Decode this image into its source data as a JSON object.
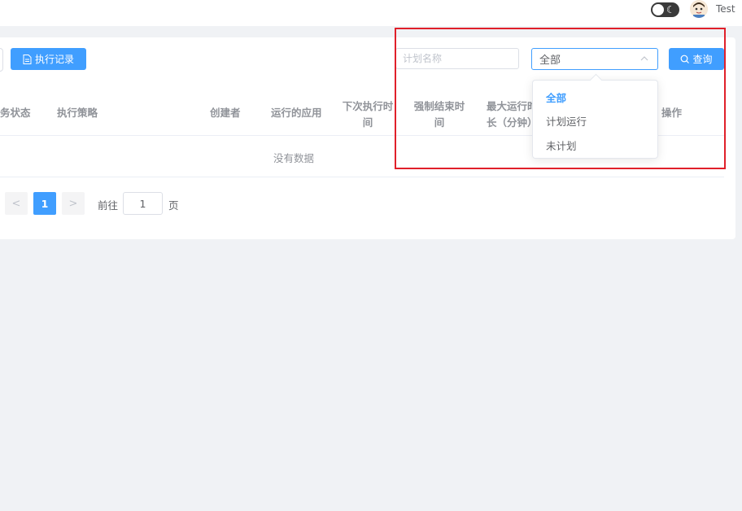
{
  "header": {
    "username": "Test"
  },
  "toolbar": {
    "records_label": "执行记录",
    "name_placeholder": "计划名称",
    "status_value": "全部",
    "query_label": "查询"
  },
  "table": {
    "columns": [
      "务状态",
      "执行策略",
      "创建者",
      "运行的应用",
      "下次执行时间",
      "强制结束时间",
      "最大运行时长（分钟）",
      "操作"
    ],
    "columns_display": {
      "next_run_1": "下次执行时",
      "next_run_2": "间",
      "force_end_1": "强制结束时",
      "force_end_2": "间",
      "max_run_1": "最大运行时",
      "max_run_2": "长（分钟）"
    },
    "empty_text": "没有数据"
  },
  "pagination": {
    "prev": "<",
    "current": "1",
    "next": ">",
    "goto_label": "前往",
    "goto_value": "1",
    "page_suffix": "页"
  },
  "dropdown": {
    "options": [
      "全部",
      "计划运行",
      "未计划"
    ],
    "selected": "全部"
  },
  "colors": {
    "primary": "#409eff",
    "highlight": "#e0202a",
    "background": "#f0f2f5"
  }
}
